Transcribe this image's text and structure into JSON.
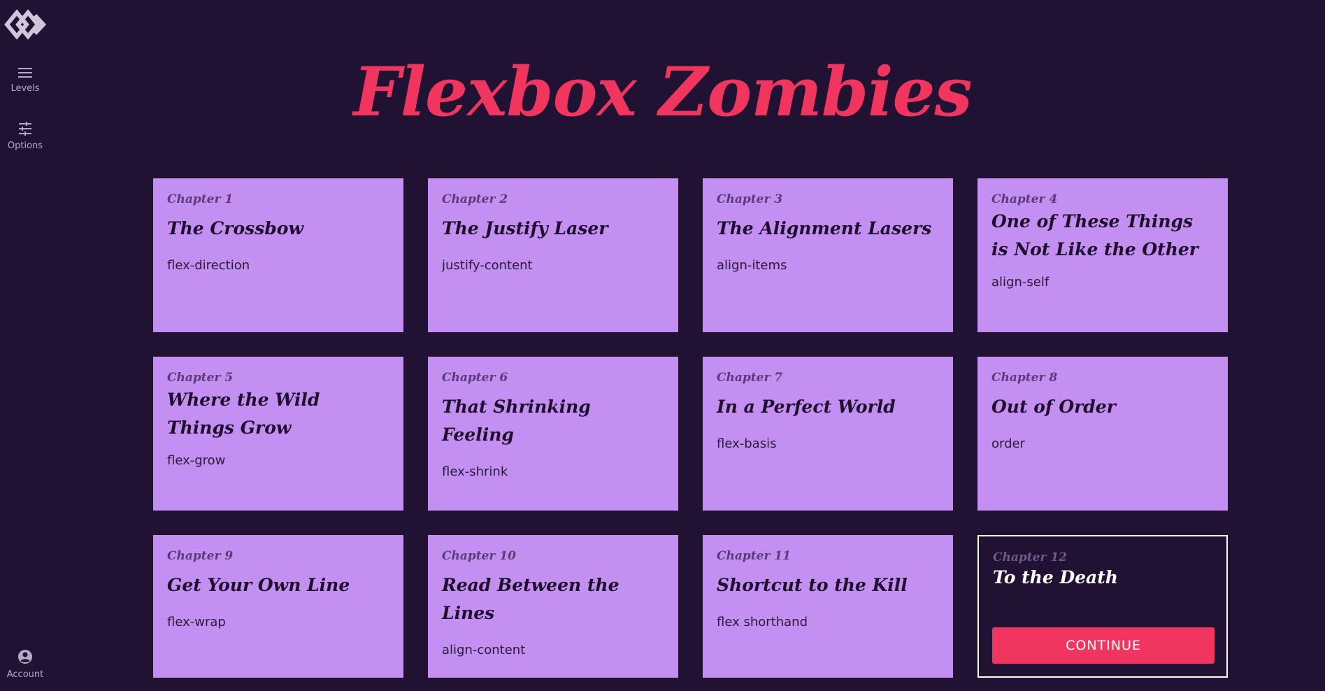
{
  "sidebar": {
    "levels_label": "Levels",
    "options_label": "Options",
    "account_label": "Account"
  },
  "title": "Flexbox Zombies",
  "colors": {
    "background": "#211133",
    "title": "#f0365f",
    "card": "#c38ff0",
    "button": "#f0365f"
  },
  "chapters": [
    {
      "chapter": "Chapter 1",
      "name": "The Crossbow",
      "property": "flex-direction"
    },
    {
      "chapter": "Chapter 2",
      "name": "The Justify Laser",
      "property": "justify-content"
    },
    {
      "chapter": "Chapter 3",
      "name": "The Alignment Lasers",
      "property": "align-items"
    },
    {
      "chapter": "Chapter 4",
      "name": "One of These Things is Not Like the Other",
      "property": "align-self"
    },
    {
      "chapter": "Chapter 5",
      "name": "Where the Wild Things Grow",
      "property": "flex-grow"
    },
    {
      "chapter": "Chapter 6",
      "name": "That Shrinking Feeling",
      "property": "flex-shrink"
    },
    {
      "chapter": "Chapter 7",
      "name": "In a Perfect World",
      "property": "flex-basis"
    },
    {
      "chapter": "Chapter 8",
      "name": "Out of Order",
      "property": "order"
    },
    {
      "chapter": "Chapter 9",
      "name": "Get Your Own Line",
      "property": "flex-wrap"
    },
    {
      "chapter": "Chapter 10",
      "name": "Read Between the Lines",
      "property": "align-content"
    },
    {
      "chapter": "Chapter 11",
      "name": "Shortcut to the Kill",
      "property": "flex shorthand"
    },
    {
      "chapter": "Chapter 12",
      "name": "To the Death",
      "button": "CONTINUE"
    }
  ],
  "icons": [
    "logo-icon",
    "menu-icon",
    "sliders-icon",
    "account-icon"
  ]
}
